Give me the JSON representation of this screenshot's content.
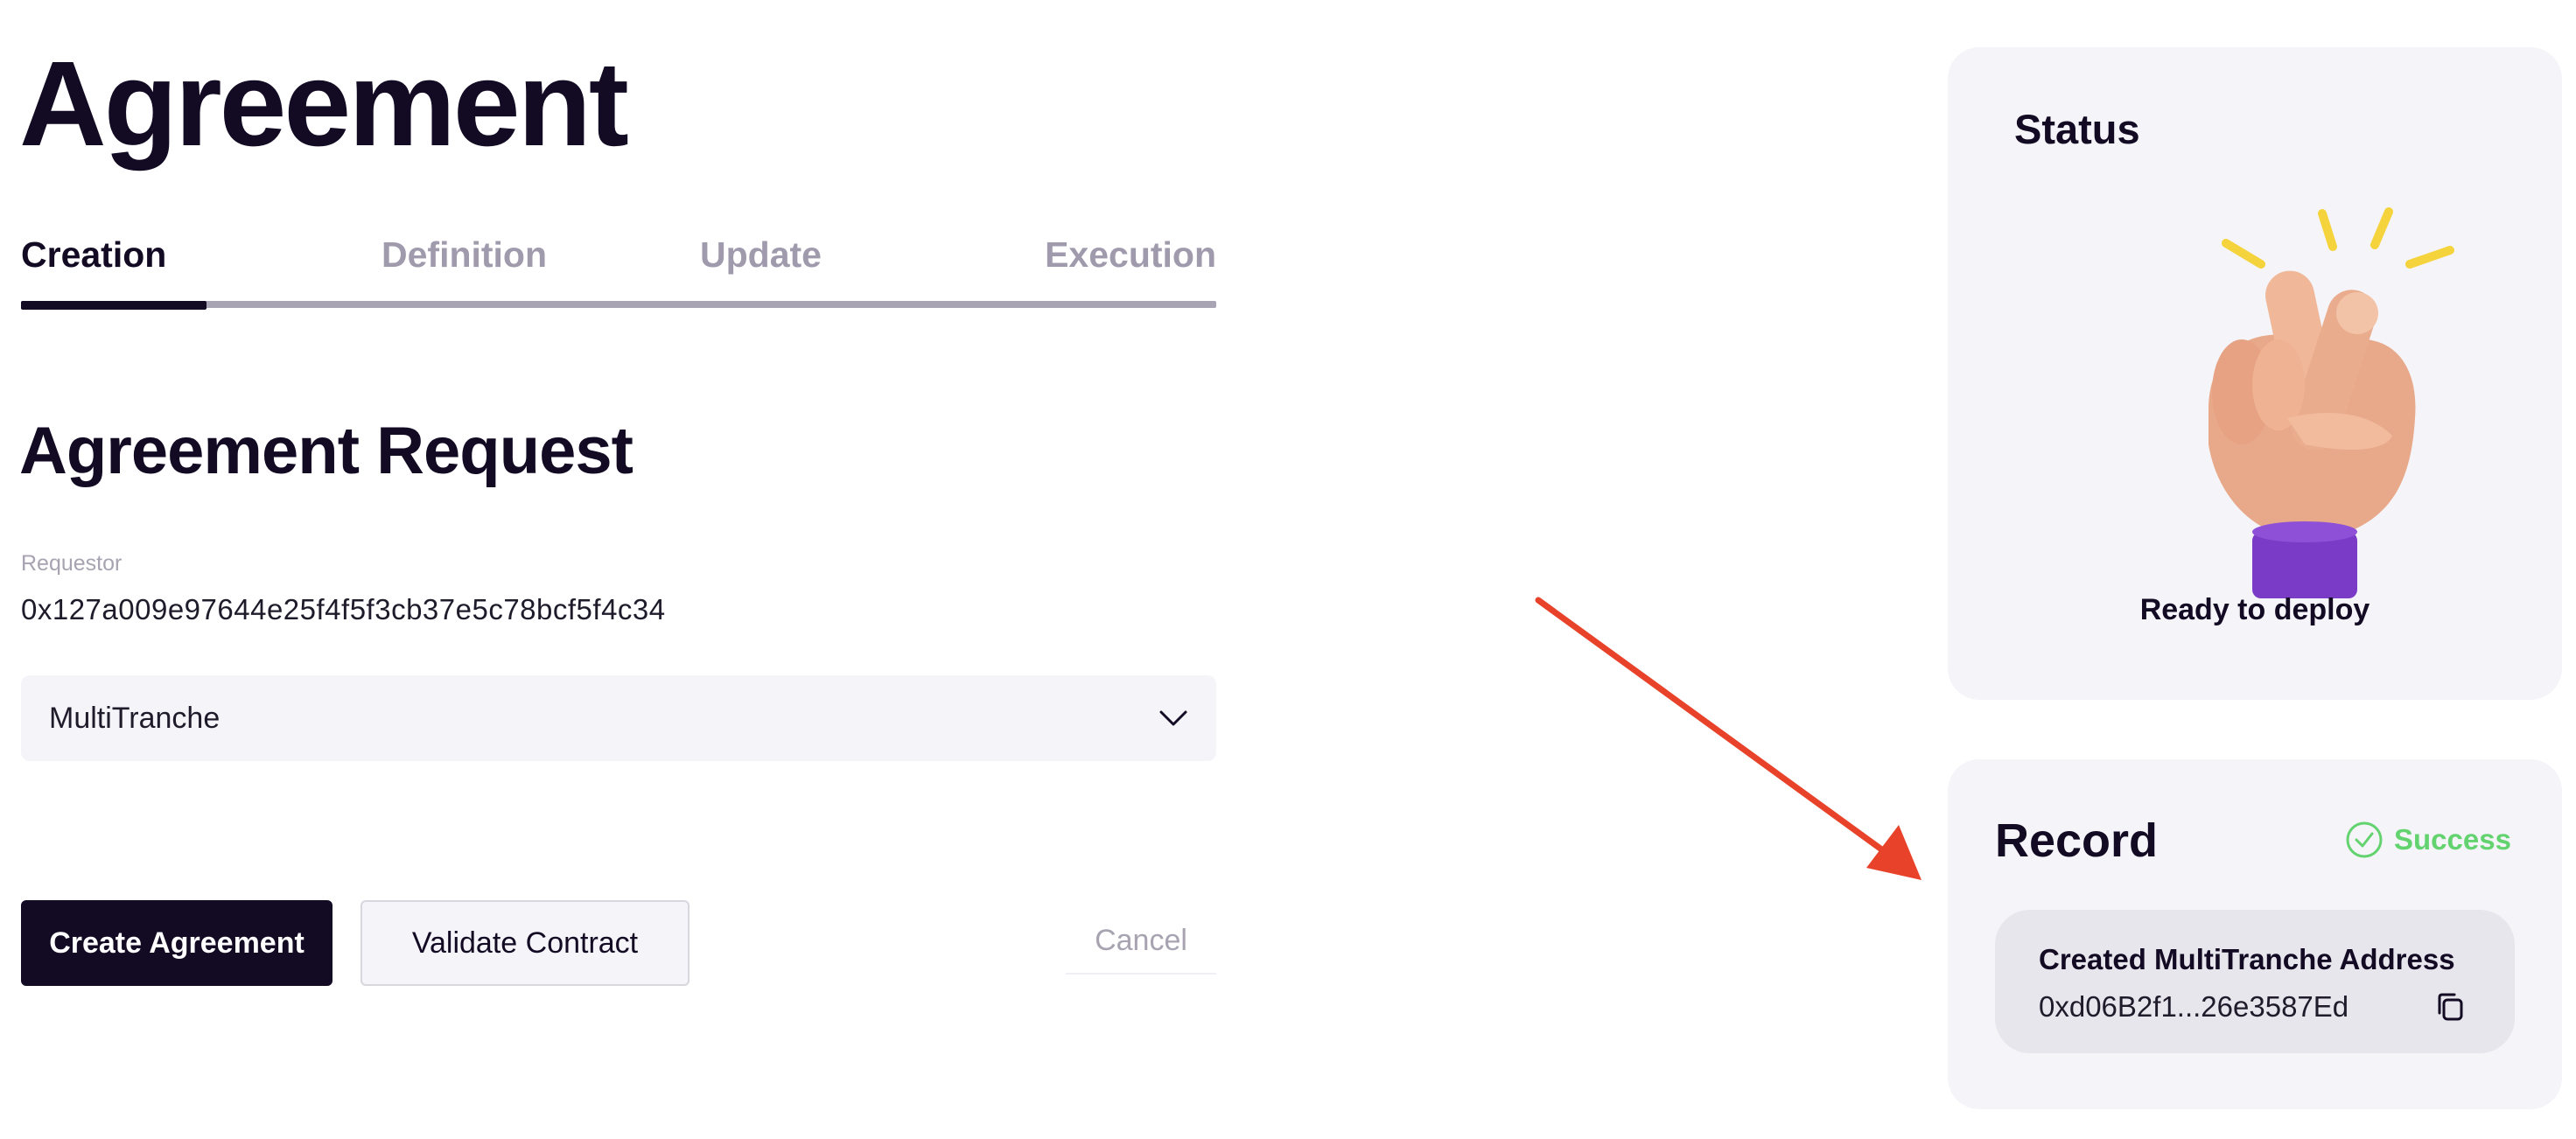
{
  "page": {
    "title": "Agreement"
  },
  "tabs": [
    {
      "label": "Creation",
      "active": true
    },
    {
      "label": "Definition",
      "active": false
    },
    {
      "label": "Update",
      "active": false
    },
    {
      "label": "Execution",
      "active": false
    }
  ],
  "request": {
    "title": "Agreement Request",
    "requestor_label": "Requestor",
    "requestor_value": "0x127a009e97644e25f4f5f3cb37e5c78bcf5f4c34",
    "type_select": {
      "value": "MultiTranche",
      "icon": "chevron-down-icon"
    }
  },
  "actions": {
    "create_label": "Create Agreement",
    "validate_label": "Validate Contract",
    "cancel_label": "Cancel"
  },
  "annotation": {
    "icon": "arrow-icon",
    "color": "#e8432a"
  },
  "status": {
    "title": "Status",
    "illustration": "crossed-fingers-hand",
    "text": "Ready to deploy"
  },
  "record": {
    "title": "Record",
    "status_label": "Success",
    "status_color": "#63d36f",
    "address_label": "Created MultiTranche Address",
    "address_value": "0xd06B2f1...26e3587Ed",
    "copy_icon": "copy-icon"
  },
  "colors": {
    "primary": "#130a23",
    "panel": "#f5f4f9",
    "muted": "#a8a3b1"
  }
}
